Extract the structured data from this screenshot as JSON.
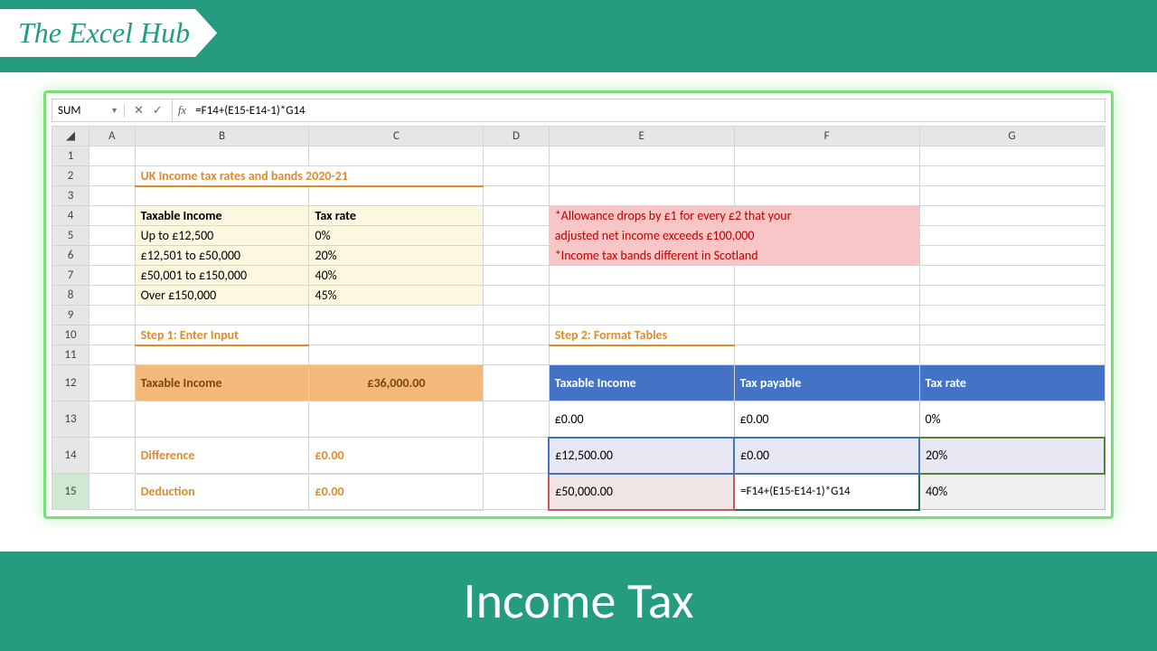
{
  "brand": "The Excel Hub",
  "footer": "Income Tax",
  "namebox": "SUM",
  "formula": "=F14+(E15-E14-1)*G14",
  "cols": [
    "A",
    "B",
    "C",
    "D",
    "E",
    "F",
    "G"
  ],
  "title": "UK Income tax rates and bands 2020-21",
  "hdr_income": "Taxable Income",
  "hdr_rate": "Tax rate",
  "bands": [
    {
      "income": "Up to £12,500",
      "rate": "0%"
    },
    {
      "income": "£12,501 to £50,000",
      "rate": "20%"
    },
    {
      "income": "£50,001 to £150,000",
      "rate": "40%"
    },
    {
      "income": "Over £150,000",
      "rate": "45%"
    }
  ],
  "note1": "*Allowance drops by £1 for every £2 that your",
  "note2": "adjusted net income exceeds £100,000",
  "note3": "*Income tax bands different in Scotland",
  "step1": "Step 1: Enter Input",
  "step2": "Step 2: Format Tables",
  "inp_label": "Taxable Income",
  "inp_value": "£36,000.00",
  "diff_label": "Difference",
  "diff_value": "£0.00",
  "ded_label": "Deduction",
  "ded_value": "£0.00",
  "t2_h1": "Taxable Income",
  "t2_h2": "Tax payable",
  "t2_h3": "Tax rate",
  "t2": {
    "r13": {
      "e": "£0.00",
      "f": "£0.00",
      "g": "0%"
    },
    "r14": {
      "e": "£12,500.00",
      "f": "£0.00",
      "g": "20%"
    },
    "r15": {
      "e": "£50,000.00",
      "f": "=F14+(E15-E14-1)*G14",
      "g": "40%"
    }
  }
}
